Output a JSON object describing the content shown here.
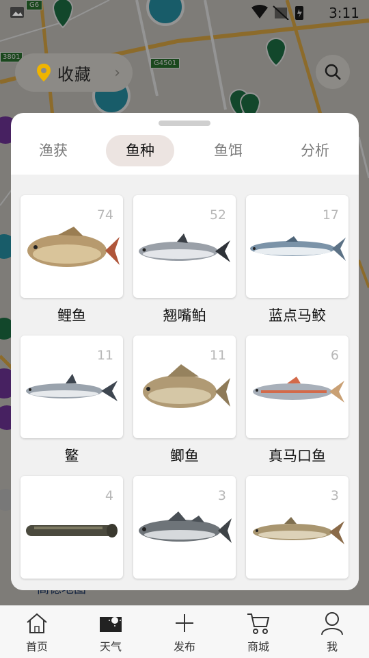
{
  "status_bar": {
    "time": "3:11"
  },
  "map": {
    "highway_labels": [
      "G6",
      "G4501",
      "3801"
    ],
    "favorites_label": "收藏",
    "watermark": "高德地图"
  },
  "sheet": {
    "tabs": [
      {
        "label": "渔获",
        "active": false
      },
      {
        "label": "鱼种",
        "active": true
      },
      {
        "label": "鱼饵",
        "active": false
      },
      {
        "label": "分析",
        "active": false
      }
    ],
    "species": [
      {
        "name": "鲤鱼",
        "count": "74",
        "icon": "carp-fish"
      },
      {
        "name": "翘嘴鲌",
        "count": "52",
        "icon": "topmouth-culter-fish"
      },
      {
        "name": "蓝点马鲛",
        "count": "17",
        "icon": "spanish-mackerel-fish"
      },
      {
        "name": "鳘",
        "count": "11",
        "icon": "sharpbelly-fish"
      },
      {
        "name": "鲫鱼",
        "count": "11",
        "icon": "crucian-carp-fish"
      },
      {
        "name": "真马口鱼",
        "count": "6",
        "icon": "chinese-hooksnout-fish"
      },
      {
        "name": "",
        "count": "4",
        "icon": "snakehead-fish"
      },
      {
        "name": "",
        "count": "3",
        "icon": "sea-bass-fish"
      },
      {
        "name": "",
        "count": "3",
        "icon": "grass-carp-fish"
      }
    ]
  },
  "nav": {
    "items": [
      {
        "label": "首页",
        "icon": "home-icon"
      },
      {
        "label": "天气",
        "icon": "weather-icon"
      },
      {
        "label": "发布",
        "icon": "plus-icon"
      },
      {
        "label": "商城",
        "icon": "cart-icon"
      },
      {
        "label": "我",
        "icon": "profile-icon"
      }
    ]
  },
  "colors": {
    "active_tab_bg": "#ece4e1",
    "pin_accent": "#f0b400",
    "map_marker": "#1f7a4a",
    "count_text": "#b7b7b7"
  }
}
